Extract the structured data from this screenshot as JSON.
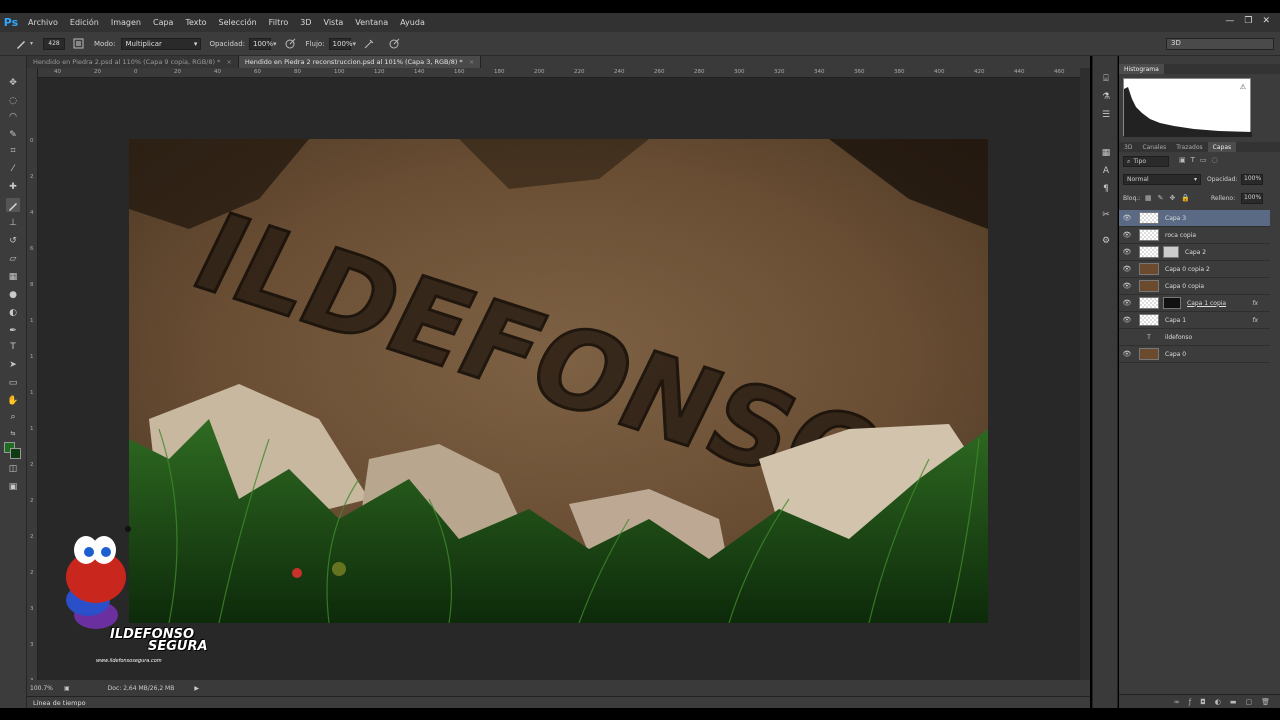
{
  "app": {
    "logo": "Ps"
  },
  "menu": [
    "Archivo",
    "Edición",
    "Imagen",
    "Capa",
    "Texto",
    "Selección",
    "Filtro",
    "3D",
    "Vista",
    "Ventana",
    "Ayuda"
  ],
  "options": {
    "brush_size": "428",
    "mode_label": "Modo:",
    "mode_value": "Multiplicar",
    "opacity_label": "Opacidad:",
    "opacity_value": "100%",
    "flow_label": "Flujo:",
    "flow_value": "100%",
    "workspace": "3D"
  },
  "tabs": [
    {
      "label": "Hendido en Piedra 2.psd al 110% (Capa 9 copia, RGB/8) *",
      "close": "×"
    },
    {
      "label": "Hendido en Piedra 2 reconstruccion.psd al 101% (Capa 3, RGB/8) *",
      "close": "×"
    }
  ],
  "ruler_h": [
    "40",
    "20",
    "0",
    "20",
    "40",
    "60",
    "80",
    "100",
    "120",
    "140",
    "160",
    "180",
    "200",
    "220",
    "240",
    "260",
    "280",
    "300",
    "320",
    "340",
    "360",
    "380",
    "400",
    "420",
    "440",
    "460"
  ],
  "ruler_v": [
    "0",
    "2",
    "4",
    "6",
    "8",
    "1",
    "1",
    "1",
    "1",
    "2",
    "2",
    "2",
    "2",
    "3",
    "3",
    "3"
  ],
  "canvas": {
    "engraved_text": "ILDEFONSO",
    "watermark_line1": "ILDEFONSO",
    "watermark_line2": "SEGURA",
    "watermark_url": "www.ildefonsosegura.com"
  },
  "status": {
    "zoom": "100.7%",
    "doc": "Doc: 2,64 MB/26,2 MB"
  },
  "timeline_label": "Línea de tiempo",
  "panels": {
    "histogram_tab": "Histograma",
    "layer_tabs": [
      "3D",
      "Canales",
      "Trazados",
      "Capas"
    ],
    "filter_kind": "Tipo",
    "blend_mode": "Normal",
    "opacity_label": "Opacidad:",
    "opacity_value": "100%",
    "lock_label": "Bloq.:",
    "fill_label": "Relleno:",
    "fill_value": "100%"
  },
  "layers": [
    {
      "name": "Capa 3",
      "selected": true
    },
    {
      "name": "roca copia",
      "selected": false
    },
    {
      "name": "Capa 2",
      "selected": false
    },
    {
      "name": "Capa 0 copia 2",
      "selected": false
    },
    {
      "name": "Capa 0 copia",
      "selected": false
    },
    {
      "name": "Capa 1 copia",
      "selected": false,
      "fx": "fx"
    },
    {
      "name": "Capa 1",
      "selected": false,
      "fx": "fx"
    },
    {
      "name": "ildefonso",
      "selected": false
    },
    {
      "name": "Capa 0",
      "selected": false
    }
  ],
  "colors": {
    "accent_blue": "#31a8ff",
    "selected_layer": "#5a6a84",
    "foreground": "#1e6b22",
    "background": "#0f3a12"
  }
}
